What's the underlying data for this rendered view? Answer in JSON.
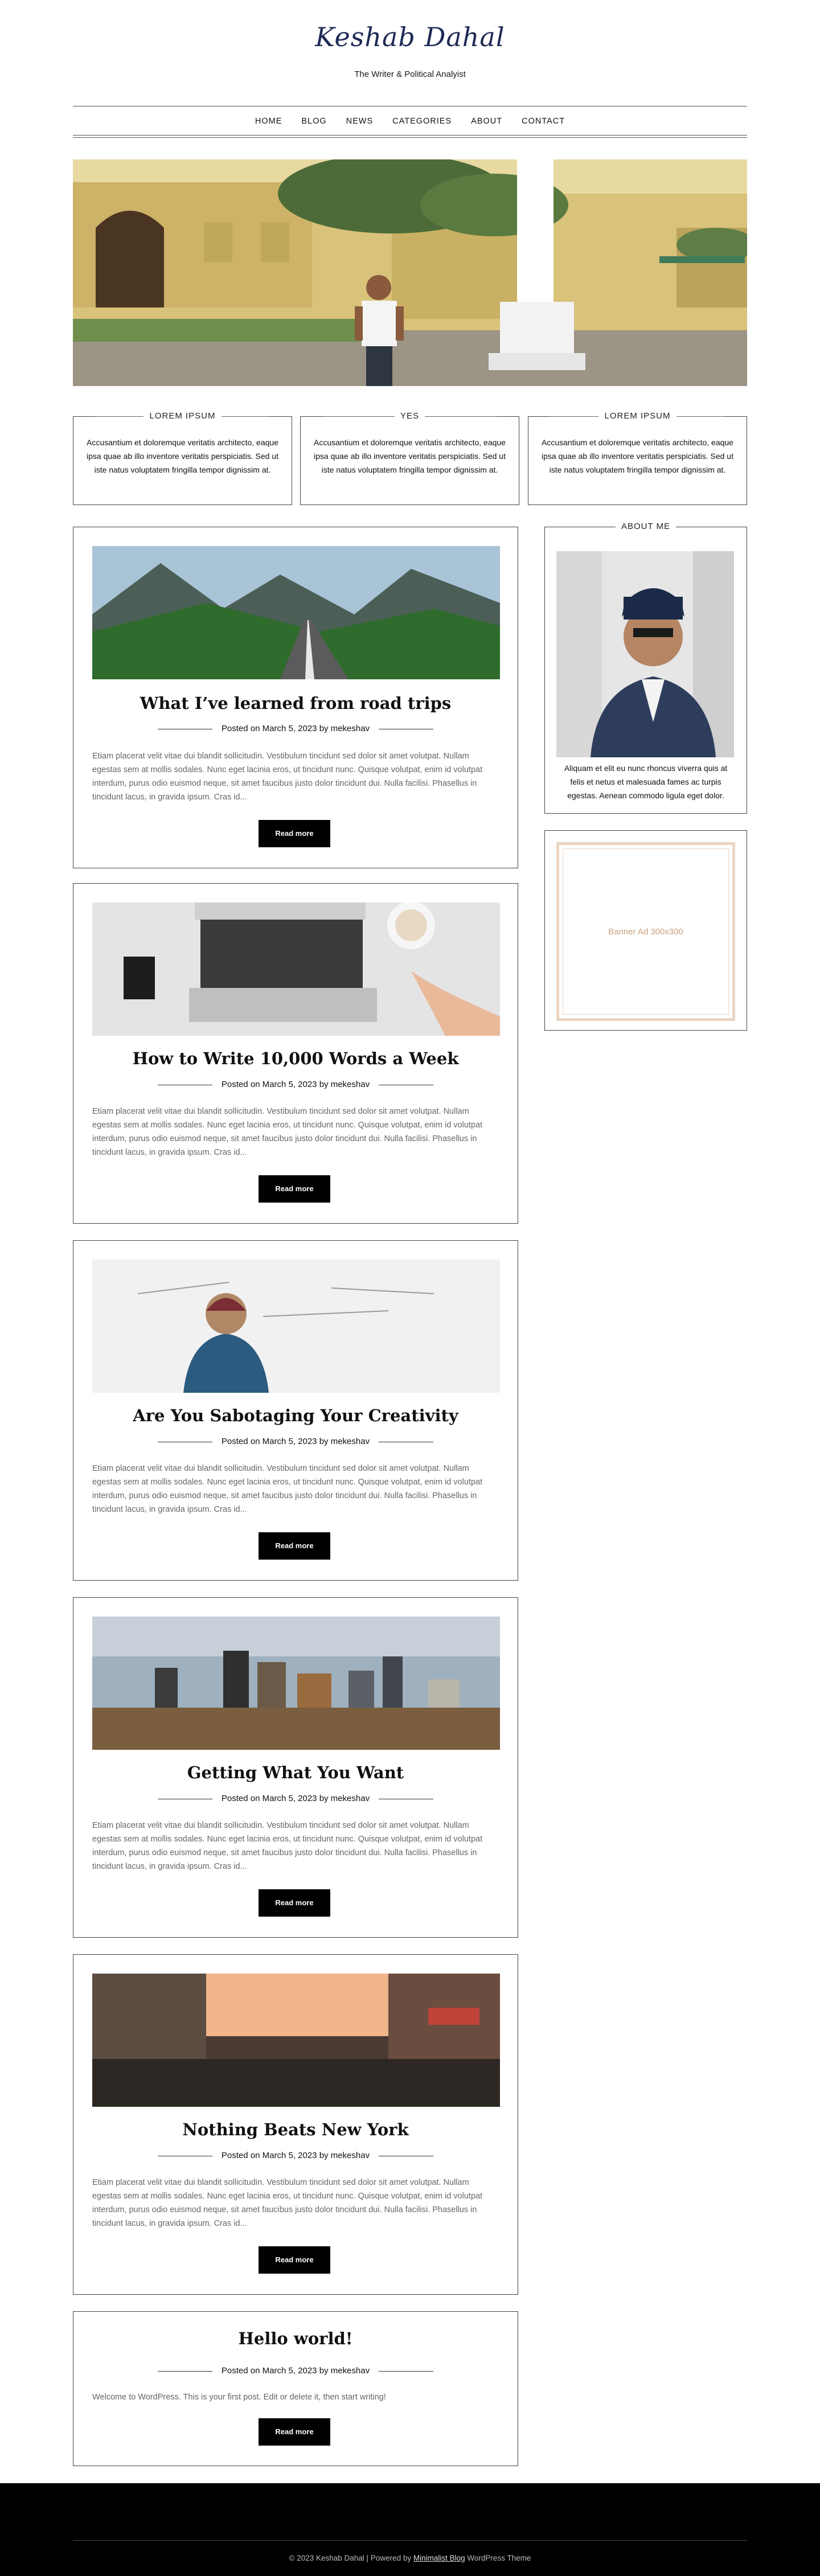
{
  "site": {
    "logo": "Keshab Dahal",
    "tagline": "The Writer & Political Analyist"
  },
  "nav": {
    "items": [
      "HOME",
      "BLOG",
      "NEWS",
      "CATEGORIES",
      "ABOUT",
      "CONTACT"
    ]
  },
  "promos": [
    {
      "title": "LOREM IPSUM",
      "text": "Accusantium et doloremque veritatis architecto, eaque ipsa quae ab illo inventore veritatis perspiciatis. Sed ut iste natus voluptatem fringilla tempor dignissim at."
    },
    {
      "title": "YES",
      "text": "Accusantium et doloremque veritatis architecto, eaque ipsa quae ab illo inventore veritatis perspiciatis. Sed ut iste natus voluptatem fringilla tempor dignissim at."
    },
    {
      "title": "LOREM IPSUM",
      "text": "Accusantium et doloremque veritatis architecto, eaque ipsa quae ab illo inventore veritatis perspiciatis. Sed ut iste natus voluptatem fringilla tempor dignissim at."
    }
  ],
  "posts": [
    {
      "title": "What I’ve learned from road trips",
      "meta": "Posted on March 5, 2023 by mekeshav",
      "excerpt": "Etiam placerat velit vitae dui blandit sollicitudin. Vestibulum tincidunt sed dolor sit amet volutpat. Nullam egestas sem at mollis sodales. Nunc eget lacinia eros, ut tincidunt nunc. Quisque volutpat, enim id volutpat interdum, purus odio euismod neque, sit amet faucibus justo dolor tincidunt dui. Nulla facilisi. Phasellus in tincidunt lacus, in gravida ipsum. Cras id...",
      "button": "Read more"
    },
    {
      "title": "How to Write 10,000 Words a Week",
      "meta": "Posted on March 5, 2023 by mekeshav",
      "excerpt": "Etiam placerat velit vitae dui blandit sollicitudin. Vestibulum tincidunt sed dolor sit amet volutpat. Nullam egestas sem at mollis sodales. Nunc eget lacinia eros, ut tincidunt nunc. Quisque volutpat, enim id volutpat interdum, purus odio euismod neque, sit amet faucibus justo dolor tincidunt dui. Nulla facilisi. Phasellus in tincidunt lacus, in gravida ipsum. Cras id...",
      "button": "Read more"
    },
    {
      "title": "Are You Sabotaging Your Creativity",
      "meta": "Posted on March 5, 2023 by mekeshav",
      "excerpt": "Etiam placerat velit vitae dui blandit sollicitudin. Vestibulum tincidunt sed dolor sit amet volutpat. Nullam egestas sem at mollis sodales. Nunc eget lacinia eros, ut tincidunt nunc. Quisque volutpat, enim id volutpat interdum, purus odio euismod neque, sit amet faucibus justo dolor tincidunt dui. Nulla facilisi. Phasellus in tincidunt lacus, in gravida ipsum. Cras id...",
      "button": "Read more"
    },
    {
      "title": "Getting What You Want",
      "meta": "Posted on March 5, 2023 by mekeshav",
      "excerpt": "Etiam placerat velit vitae dui blandit sollicitudin. Vestibulum tincidunt sed dolor sit amet volutpat. Nullam egestas sem at mollis sodales. Nunc eget lacinia eros, ut tincidunt nunc. Quisque volutpat, enim id volutpat interdum, purus odio euismod neque, sit amet faucibus justo dolor tincidunt dui. Nulla facilisi. Phasellus in tincidunt lacus, in gravida ipsum. Cras id...",
      "button": "Read more"
    },
    {
      "title": "Nothing Beats New York",
      "meta": "Posted on March 5, 2023 by mekeshav",
      "excerpt": "Etiam placerat velit vitae dui blandit sollicitudin. Vestibulum tincidunt sed dolor sit amet volutpat. Nullam egestas sem at mollis sodales. Nunc eget lacinia eros, ut tincidunt nunc. Quisque volutpat, enim id volutpat interdum, purus odio euismod neque, sit amet faucibus justo dolor tincidunt dui. Nulla facilisi. Phasellus in tincidunt lacus, in gravida ipsum. Cras id...",
      "button": "Read more"
    },
    {
      "title": "Hello world!",
      "meta": "Posted on March 5, 2023 by mekeshav",
      "excerpt": "Welcome to WordPress. This is your first post. Edit or delete it, then start writing!",
      "button": "Read more"
    }
  ],
  "sidebar": {
    "about_title": "ABOUT ME",
    "about_text": "Aliquam et elit eu nunc rhoncus viverra quis at felis et netus et malesuada fames ac turpis egestas. Aenean commodo ligula eget dolor.",
    "banner_text": "Banner Ad 300x300"
  },
  "footer": {
    "prefix": "© 2023 Keshab Dahal | Powered by",
    "link": "Minimalist Blog",
    "suffix": "WordPress Theme"
  }
}
